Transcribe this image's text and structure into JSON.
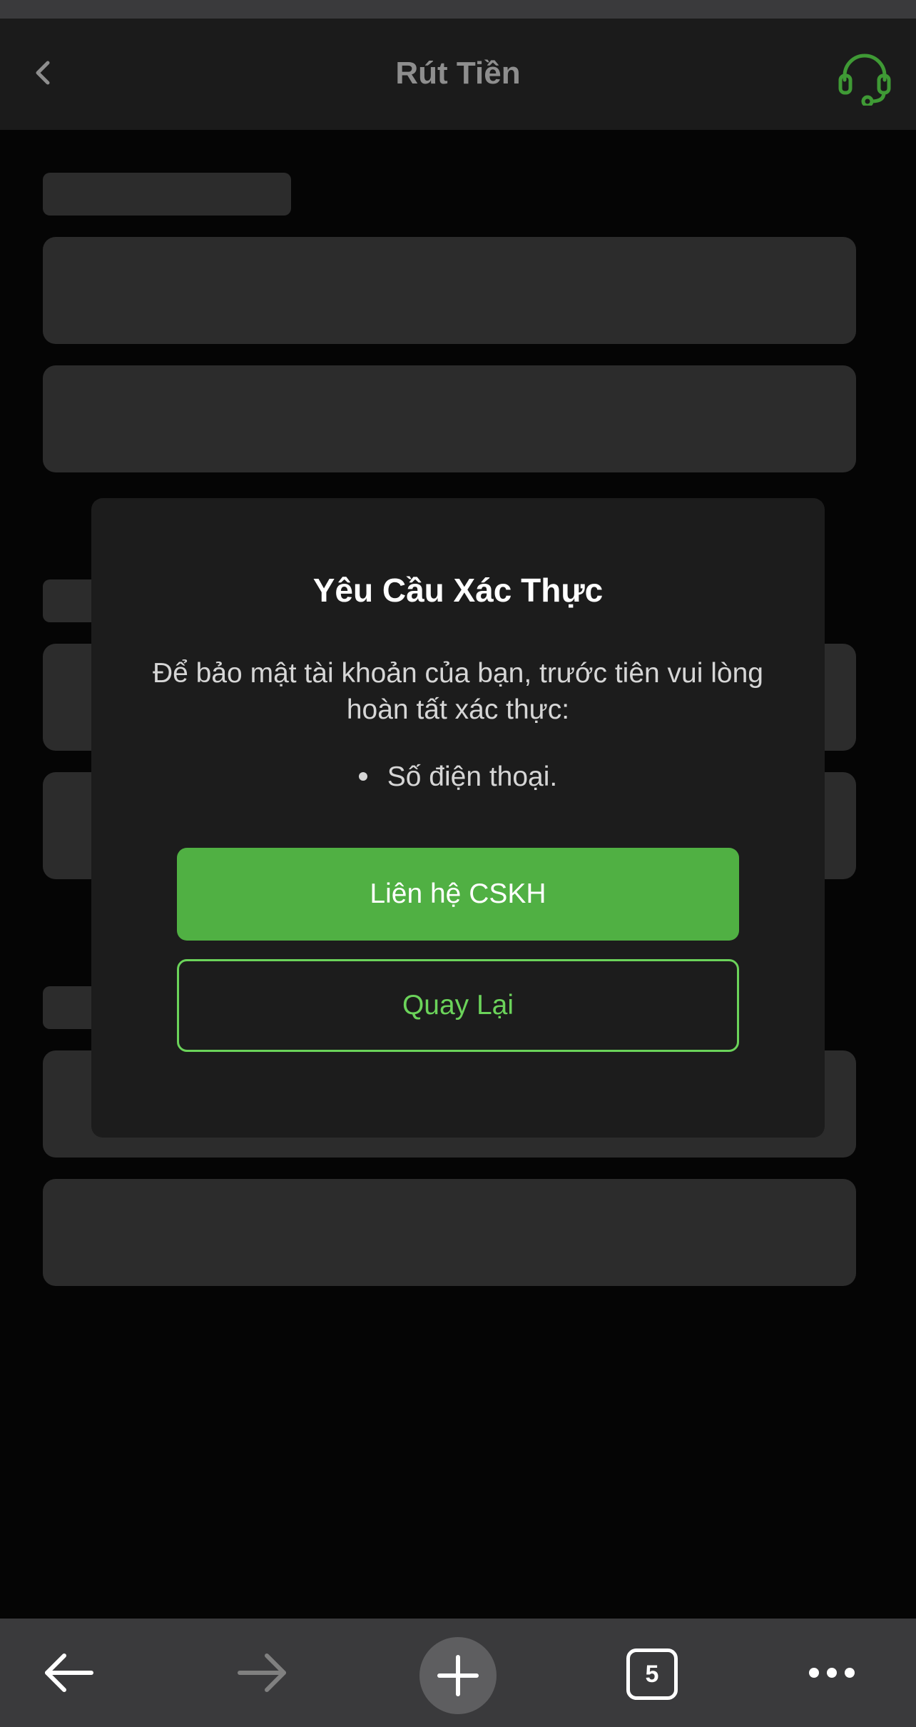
{
  "header": {
    "title": "Rút Tiền",
    "back_icon": "chevron-left-icon",
    "support_icon": "headset-icon",
    "accent_color": "#3f9a35"
  },
  "dialog": {
    "title": "Yêu Cầu Xác Thực",
    "message": "Để bảo mật tài khoản của bạn, trước tiên vui lòng hoàn tất xác thực:",
    "requirements": [
      "Số điện thoại."
    ],
    "primary_button_label": "Liên hệ CSKH",
    "secondary_button_label": "Quay Lại",
    "primary_color": "#50b043",
    "outline_color": "#6bd35a"
  },
  "browser_bar": {
    "back_icon": "arrow-left-icon",
    "forward_icon": "arrow-right-icon",
    "new_tab_icon": "plus-icon",
    "tab_count": "5",
    "more_icon": "more-horizontal-icon"
  }
}
